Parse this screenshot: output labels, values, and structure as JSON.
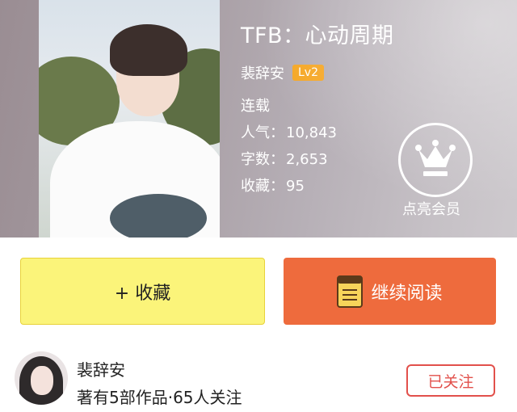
{
  "book": {
    "title": "TFB：心动周期",
    "author": "裴辞安",
    "level": "Lv2",
    "status": "连载",
    "popularity_label": "人气：",
    "popularity_value": "10,843",
    "words_label": "字数：",
    "words_value": "2,653",
    "favorites_label": "收藏：",
    "favorites_value": "95"
  },
  "vip": {
    "label": "点亮会员",
    "icon": "crown-icon"
  },
  "actions": {
    "collect_label": "+ 收藏",
    "read_label": "继续阅读",
    "read_icon": "book-icon"
  },
  "profile": {
    "name": "裴辞安",
    "meta": "著有5部作品·65人关注",
    "follow_label": "已关注"
  },
  "colors": {
    "level_badge": "#f5a623",
    "collect_bg": "#fbf47a",
    "read_bg": "#ee6b3d",
    "follow_accent": "#e2504b"
  }
}
